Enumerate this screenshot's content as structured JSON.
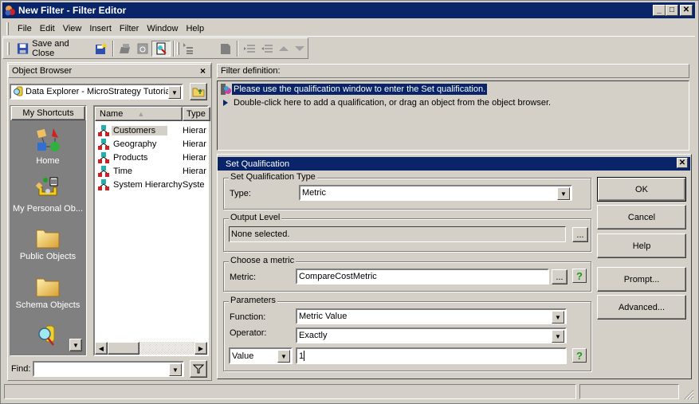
{
  "window": {
    "title": "New Filter - Filter Editor",
    "controls": [
      "minimize",
      "maximize",
      "close"
    ]
  },
  "menubar": {
    "items": [
      {
        "label": "File",
        "mnemonic": "F"
      },
      {
        "label": "Edit",
        "mnemonic": "E"
      },
      {
        "label": "View",
        "mnemonic": "V"
      },
      {
        "label": "Insert",
        "mnemonic": "r"
      },
      {
        "label": "Filter",
        "mnemonic": "t"
      },
      {
        "label": "Window",
        "mnemonic": "W"
      },
      {
        "label": "Help",
        "mnemonic": "H"
      }
    ]
  },
  "toolbar": {
    "save_close_label": "Save and Close",
    "icons": [
      "save-icon",
      "save-as-icon",
      "print-icon",
      "export-icon",
      "view-sql-icon",
      "outline-icon",
      "shape-icon",
      "indent-icon",
      "outdent-icon",
      "move-up-icon",
      "move-down-icon"
    ]
  },
  "object_browser": {
    "title": "Object Browser",
    "close_label": "×",
    "source_select": "Data Explorer - MicroStrategy Tutorial",
    "shortcuts_header": "My Shortcuts",
    "shortcuts": [
      {
        "label": "Home",
        "icon": "home-icon"
      },
      {
        "label": "My Personal Ob...",
        "icon": "personal-objects-icon"
      },
      {
        "label": "Public Objects",
        "icon": "folder-icon"
      },
      {
        "label": "Schema Objects",
        "icon": "folder-icon"
      },
      {
        "label": "",
        "icon": "data-explorer-icon"
      }
    ],
    "columns": [
      "Name",
      "Type"
    ],
    "sort_indicator": "▲",
    "rows": [
      {
        "name": "Customers",
        "type": "Hierar",
        "selected": true
      },
      {
        "name": "Geography",
        "type": "Hierar"
      },
      {
        "name": "Products",
        "type": "Hierar"
      },
      {
        "name": "Time",
        "type": "Hierar"
      },
      {
        "name": "System Hierarchy",
        "type": "Syste"
      }
    ],
    "find_label": "Find:",
    "find_value": ""
  },
  "filter_definition": {
    "header": "Filter definition:",
    "lines": [
      "Please use the qualification window to enter the Set qualification.",
      "Double-click here to add a qualification, or drag an object from the object browser."
    ]
  },
  "set_qualification": {
    "title": "Set Qualification",
    "type_group": {
      "legend": "Set Qualification Type",
      "label": "Type:",
      "value": "Metric"
    },
    "output_group": {
      "legend": "Output Level",
      "value": "None selected.",
      "browse": "..."
    },
    "metric_group": {
      "legend": "Choose a metric",
      "label": "Metric:",
      "value": "CompareCostMetric",
      "browse": "..."
    },
    "params_group": {
      "legend": "Parameters",
      "function_label": "Function:",
      "function_value": "Metric Value",
      "operator_label": "Operator:",
      "operator_value": "Exactly",
      "value_type": "Value",
      "value": "1"
    },
    "buttons": {
      "ok": "OK",
      "cancel": "Cancel",
      "help": "Help",
      "prompt": "Prompt...",
      "advanced": "Advanced..."
    }
  },
  "colors": {
    "titlebar": "#0a246a",
    "face": "#d4d0c8",
    "shortcuts_bg": "#808080"
  }
}
